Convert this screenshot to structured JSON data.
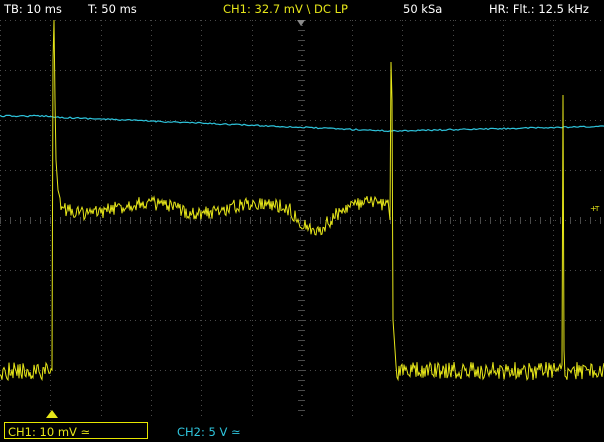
{
  "status_bar": {
    "timebase": "TB: 10 ms",
    "trigger_time": "T: 50 ms",
    "ch1_trigger": "CH1: 32.7 mV \\ DC LP",
    "sample_rate": "50 kSa",
    "hr_filter": "HR: Flt.: 12.5 kHz"
  },
  "channel_bar": {
    "ch1_setting": "CH1: 10 mV ≃",
    "ch2_setting": "CH2: 5 V ≃"
  },
  "trigger_marker_label": "T",
  "colors": {
    "background": "#000000",
    "grid": "#4a4a4a",
    "text": "#ffffff",
    "ch1": "#e6e619",
    "ch2": "#2ec4dc"
  },
  "icons": [
    "trigger-position-icon",
    "ch1-ground-marker-icon",
    "trigger-level-icon"
  ]
}
